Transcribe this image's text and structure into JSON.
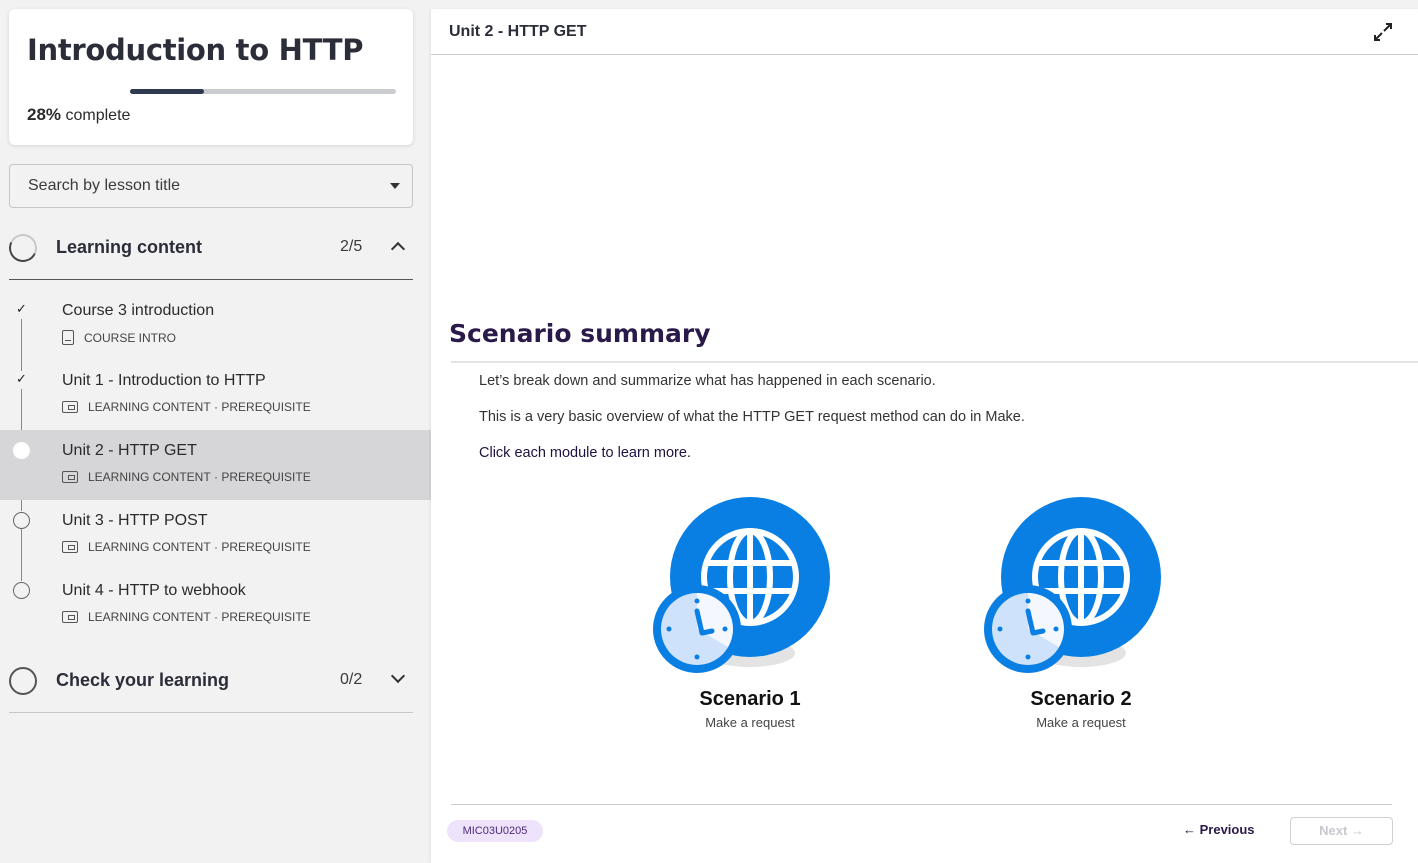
{
  "course": {
    "title": "Introduction to HTTP",
    "progress_percent": 28,
    "progress_value": "28%",
    "progress_label": "complete"
  },
  "search": {
    "placeholder": "Search by lesson title"
  },
  "sections": [
    {
      "title": "Learning content",
      "count": "2/5",
      "expanded": true
    },
    {
      "title": "Check your learning",
      "count": "0/2",
      "expanded": false
    }
  ],
  "lessons": [
    {
      "title": "Course 3 introduction",
      "type": "COURSE INTRO",
      "prereq": "",
      "done": true,
      "check": "✓"
    },
    {
      "title": "Unit 1 - Introduction to HTTP",
      "type": "LEARNING CONTENT",
      "prereq": "· PREREQUISITE",
      "done": true,
      "check": "✓"
    },
    {
      "title": "Unit 2 - HTTP GET",
      "type": "LEARNING CONTENT",
      "prereq": "· PREREQUISITE",
      "done": false,
      "active": true
    },
    {
      "title": "Unit 3 - HTTP POST",
      "type": "LEARNING CONTENT",
      "prereq": "· PREREQUISITE",
      "done": false
    },
    {
      "title": "Unit 4 - HTTP to webhook",
      "type": "LEARNING CONTENT",
      "prereq": "· PREREQUISITE",
      "done": false
    }
  ],
  "main": {
    "unit_title": "Unit 2 - HTTP GET",
    "heading": "Scenario summary",
    "para1": "Let’s break down and summarize what has happened in each scenario.",
    "para2": "This is a very basic overview of what the HTTP GET request method can do in Make.",
    "para3": "Click each module to learn more.",
    "scenarios": [
      {
        "name": "Scenario 1",
        "sub": "Make a request"
      },
      {
        "name": "Scenario 2",
        "sub": "Make a request"
      }
    ],
    "code": "MIC03U0205",
    "prev_label": "← Previous",
    "next_label": "Next →"
  },
  "colors": {
    "accent_blue": "#0a7fe3",
    "dark_purple": "#2a1a4a"
  }
}
